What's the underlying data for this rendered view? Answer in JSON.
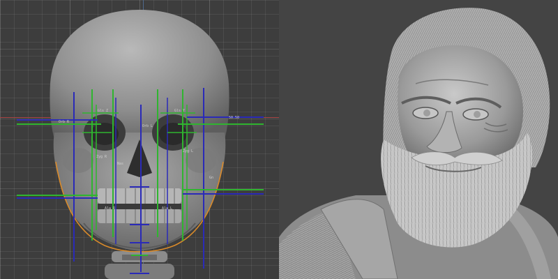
{
  "viewports": {
    "left": {
      "view": "skull-reference",
      "landmark_labels": [
        "Gls Z",
        "Gls Y",
        "Orb R",
        "Orb L",
        "Zyg R",
        "Zyg L",
        "Nas",
        "Ala R",
        "Ala L",
        "Gn"
      ],
      "corner_readout": "50.50"
    },
    "right": {
      "view": "sculpted-head"
    }
  },
  "colors": {
    "guide_green": "#2fb52f",
    "guide_blue": "#2a2ab8",
    "outline_orange": "#d98a2a",
    "axis_red": "#a84444",
    "axis_blue": "#4f6a8d",
    "viewport_bg": "#3d3d3d",
    "sculpt_bg": "#444444"
  }
}
